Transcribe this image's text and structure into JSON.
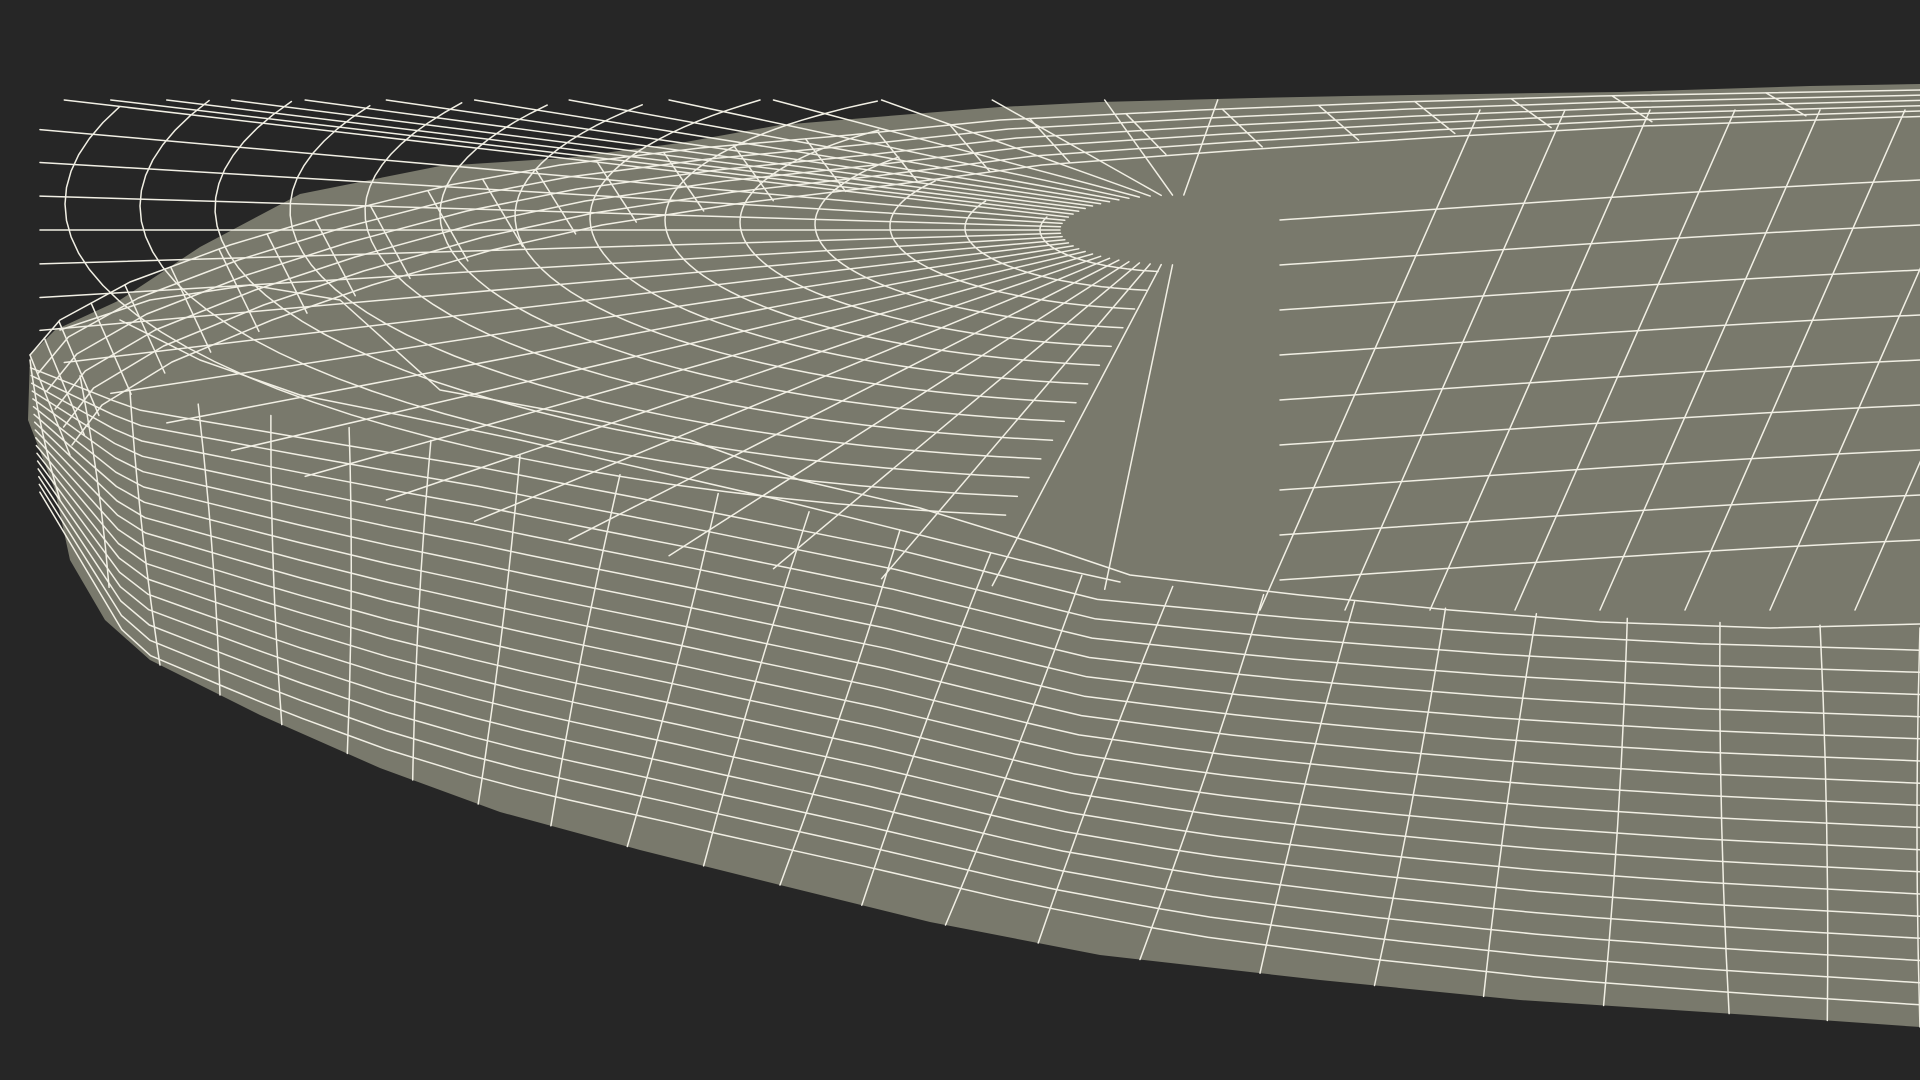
{
  "scene": {
    "subject": "wireframe-mesh",
    "colors": {
      "background": "#262626",
      "surface": "#79796c",
      "wire": "#f1efe4"
    }
  }
}
